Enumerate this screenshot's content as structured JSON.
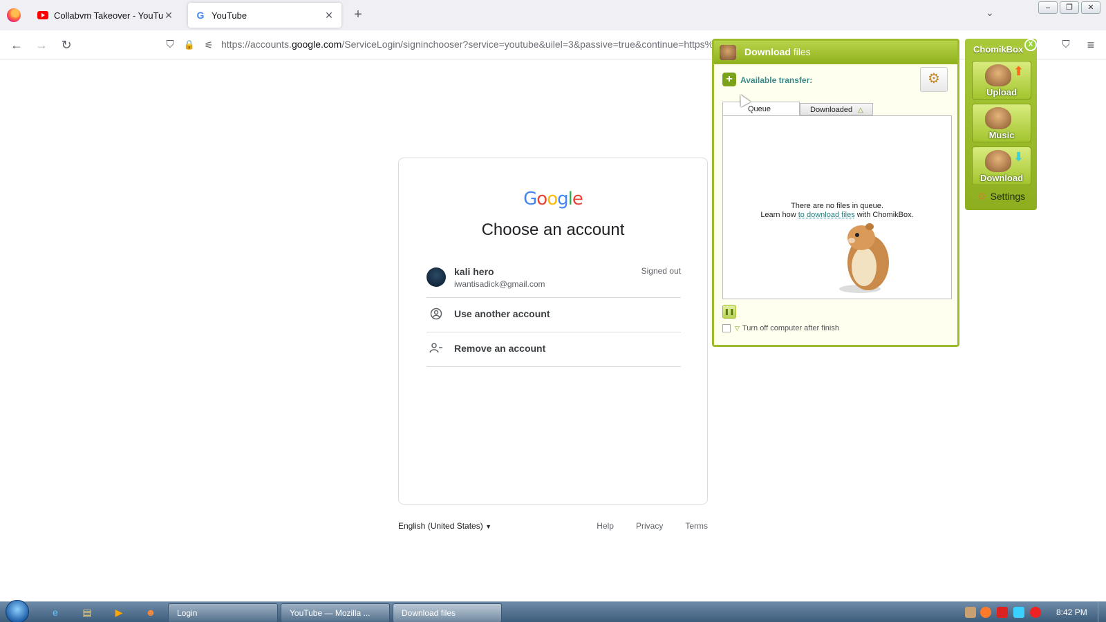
{
  "browser": {
    "tabs": [
      {
        "label": "Collabvm Takeover - YouTube",
        "active": false
      },
      {
        "label": "YouTube",
        "active": true
      }
    ],
    "new_tab_glyph": "+",
    "tablist_glyph": "⌄",
    "window_buttons": [
      "–",
      "❐",
      "✕"
    ],
    "url_prefix": "https://accounts.",
    "url_domain": "google.com",
    "url_rest": "/ServiceLogin/signinchooser?service=youtube&uilel=3&passive=true&continue=https%",
    "nav_icons": {
      "back": "←",
      "forward": "→",
      "reload": "↻",
      "shield": "⛉",
      "lock": "🔒",
      "perms": "⚟",
      "pocket": "⛉",
      "menu": "≡"
    }
  },
  "google": {
    "logo_letters": [
      {
        "ch": "G",
        "color": "#4285F4"
      },
      {
        "ch": "o",
        "color": "#EA4335"
      },
      {
        "ch": "o",
        "color": "#FBBC05"
      },
      {
        "ch": "g",
        "color": "#4285F4"
      },
      {
        "ch": "l",
        "color": "#34A853"
      },
      {
        "ch": "e",
        "color": "#EA4335"
      }
    ],
    "title": "Choose an account",
    "account": {
      "name": "kali hero",
      "email": "iwantisadick@gmail.com",
      "status": "Signed out"
    },
    "use_another": "Use another account",
    "remove": "Remove an account",
    "footer": {
      "language": "English (United States)",
      "help": "Help",
      "privacy": "Privacy",
      "terms": "Terms"
    }
  },
  "download_window": {
    "title_bold": "Download",
    "title_rest": " files",
    "available_transfer": "Available transfer:",
    "tabs": {
      "queue": "Queue",
      "downloaded": "Downloaded"
    },
    "empty_line1": "There are no files in queue.",
    "learn_prefix": "Learn how ",
    "learn_link": "to download files",
    "learn_suffix": " with ChomikBox.",
    "shutdown_label": "Turn off computer after finish"
  },
  "chomikbox": {
    "title": "ChomikBox",
    "close": "X",
    "buttons": [
      {
        "label": "Upload",
        "arrow": "⬆",
        "arrow_color": "#ff6a1a"
      },
      {
        "label": "Music",
        "arrow": "",
        "arrow_color": "#ffffff"
      },
      {
        "label": "Download",
        "arrow": "⬇",
        "arrow_color": "#3ad0d8"
      }
    ],
    "settings": "Settings"
  },
  "taskbar": {
    "buttons": [
      "Login",
      "YouTube — Mozilla ...",
      "Download files"
    ],
    "clock": "8:42 PM"
  }
}
